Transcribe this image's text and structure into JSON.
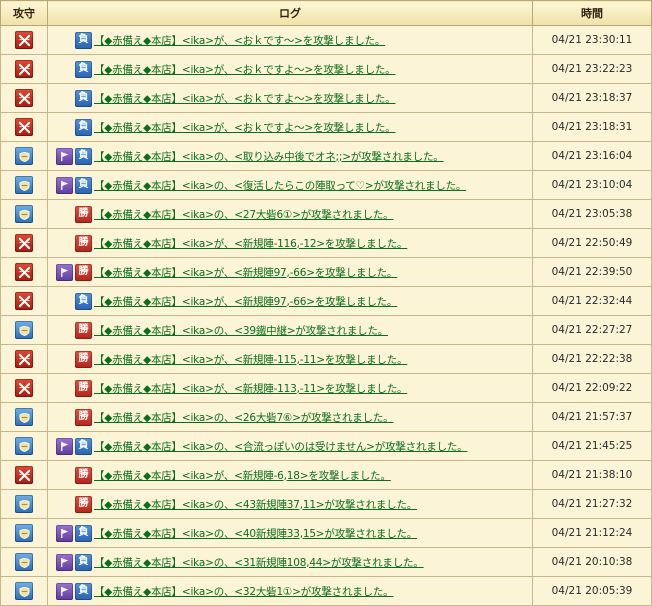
{
  "headers": {
    "side": "攻守",
    "log": "ログ",
    "time": "時間"
  },
  "colors": {
    "link": "#0c6e1c",
    "attack_icon": "#c42a1c",
    "defend_icon": "#3d7cc4",
    "lose_badge": "#3a78c6",
    "win_badge": "#c8352a",
    "join_badge": "#7a56b6",
    "row_bg": "#fbf4d6",
    "header_bg": "#f6ebbf"
  },
  "icons": {
    "attack": "crossed-swords-icon",
    "defend": "shield-icon",
    "join": "flag-icon"
  },
  "rows": [
    {
      "side": "attack",
      "join": false,
      "result_label": "負",
      "result_type": "lose",
      "text": "【◆赤備え◆本店】<ika>が、<おｋです～>を攻撃しました。",
      "time": "04/21 23:30:11"
    },
    {
      "side": "attack",
      "join": false,
      "result_label": "負",
      "result_type": "lose",
      "text": "【◆赤備え◆本店】<ika>が、<おｋですよ～>を攻撃しました。",
      "time": "04/21 23:22:23"
    },
    {
      "side": "attack",
      "join": false,
      "result_label": "負",
      "result_type": "lose",
      "text": "【◆赤備え◆本店】<ika>が、<おｋですよ～>を攻撃しました。",
      "time": "04/21 23:18:37"
    },
    {
      "side": "attack",
      "join": false,
      "result_label": "負",
      "result_type": "lose",
      "text": "【◆赤備え◆本店】<ika>が、<おｋですよ～>を攻撃しました。",
      "time": "04/21 23:18:31"
    },
    {
      "side": "defend",
      "join": true,
      "result_label": "負",
      "result_type": "lose",
      "text": "【◆赤備え◆本店】<ika>の、<取り込み中後でオネ;;>が攻撃されました。",
      "time": "04/21 23:16:04"
    },
    {
      "side": "defend",
      "join": true,
      "result_label": "負",
      "result_type": "lose",
      "text": "【◆赤備え◆本店】<ika>の、<復活したらこの陣取って♡>が攻撃されました。",
      "time": "04/21 23:10:04"
    },
    {
      "side": "defend",
      "join": false,
      "result_label": "勝",
      "result_type": "win",
      "text": "【◆赤備え◆本店】<ika>の、<27大砦6①>が攻撃されました。",
      "time": "04/21 23:05:38"
    },
    {
      "side": "attack",
      "join": false,
      "result_label": "勝",
      "result_type": "win",
      "text": "【◆赤備え◆本店】<ika>が、<新規陣-116,-12>を攻撃しました。",
      "time": "04/21 22:50:49"
    },
    {
      "side": "attack",
      "join": true,
      "result_label": "勝",
      "result_type": "win",
      "text": "【◆赤備え◆本店】<ika>が、<新規陣97,-66>を攻撃しました。",
      "time": "04/21 22:39:50"
    },
    {
      "side": "attack",
      "join": false,
      "result_label": "負",
      "result_type": "lose",
      "text": "【◆赤備え◆本店】<ika>が、<新規陣97,-66>を攻撃しました。",
      "time": "04/21 22:32:44"
    },
    {
      "side": "defend",
      "join": false,
      "result_label": "勝",
      "result_type": "win",
      "text": "【◆赤備え◆本店】<ika>の、<39鐵中継>が攻撃されました。",
      "time": "04/21 22:27:27"
    },
    {
      "side": "attack",
      "join": false,
      "result_label": "勝",
      "result_type": "win",
      "text": "【◆赤備え◆本店】<ika>が、<新規陣-115,-11>を攻撃しました。",
      "time": "04/21 22:22:38"
    },
    {
      "side": "attack",
      "join": false,
      "result_label": "勝",
      "result_type": "win",
      "text": "【◆赤備え◆本店】<ika>が、<新規陣-113,-11>を攻撃しました。",
      "time": "04/21 22:09:22"
    },
    {
      "side": "defend",
      "join": false,
      "result_label": "勝",
      "result_type": "win",
      "text": "【◆赤備え◆本店】<ika>の、<26大砦7⑥>が攻撃されました。",
      "time": "04/21 21:57:37"
    },
    {
      "side": "defend",
      "join": true,
      "result_label": "負",
      "result_type": "lose",
      "text": "【◆赤備え◆本店】<ika>の、<合流っぽいのは受けません>が攻撃されました。",
      "time": "04/21 21:45:25"
    },
    {
      "side": "attack",
      "join": false,
      "result_label": "勝",
      "result_type": "win",
      "text": "【◆赤備え◆本店】<ika>が、<新規陣-6,18>を攻撃しました。",
      "time": "04/21 21:38:10"
    },
    {
      "side": "defend",
      "join": false,
      "result_label": "勝",
      "result_type": "win",
      "text": "【◆赤備え◆本店】<ika>の、<43新規陣37,11>が攻撃されました。",
      "time": "04/21 21:27:32"
    },
    {
      "side": "defend",
      "join": true,
      "result_label": "負",
      "result_type": "lose",
      "text": "【◆赤備え◆本店】<ika>の、<40新規陣33,15>が攻撃されました。",
      "time": "04/21 21:12:24"
    },
    {
      "side": "defend",
      "join": true,
      "result_label": "負",
      "result_type": "lose",
      "text": "【◆赤備え◆本店】<ika>の、<31新規陣108,44>が攻撃されました。",
      "time": "04/21 20:10:38"
    },
    {
      "side": "defend",
      "join": true,
      "result_label": "負",
      "result_type": "lose",
      "text": "【◆赤備え◆本店】<ika>の、<32大砦1①>が攻撃されました。",
      "time": "04/21 20:05:39"
    }
  ]
}
